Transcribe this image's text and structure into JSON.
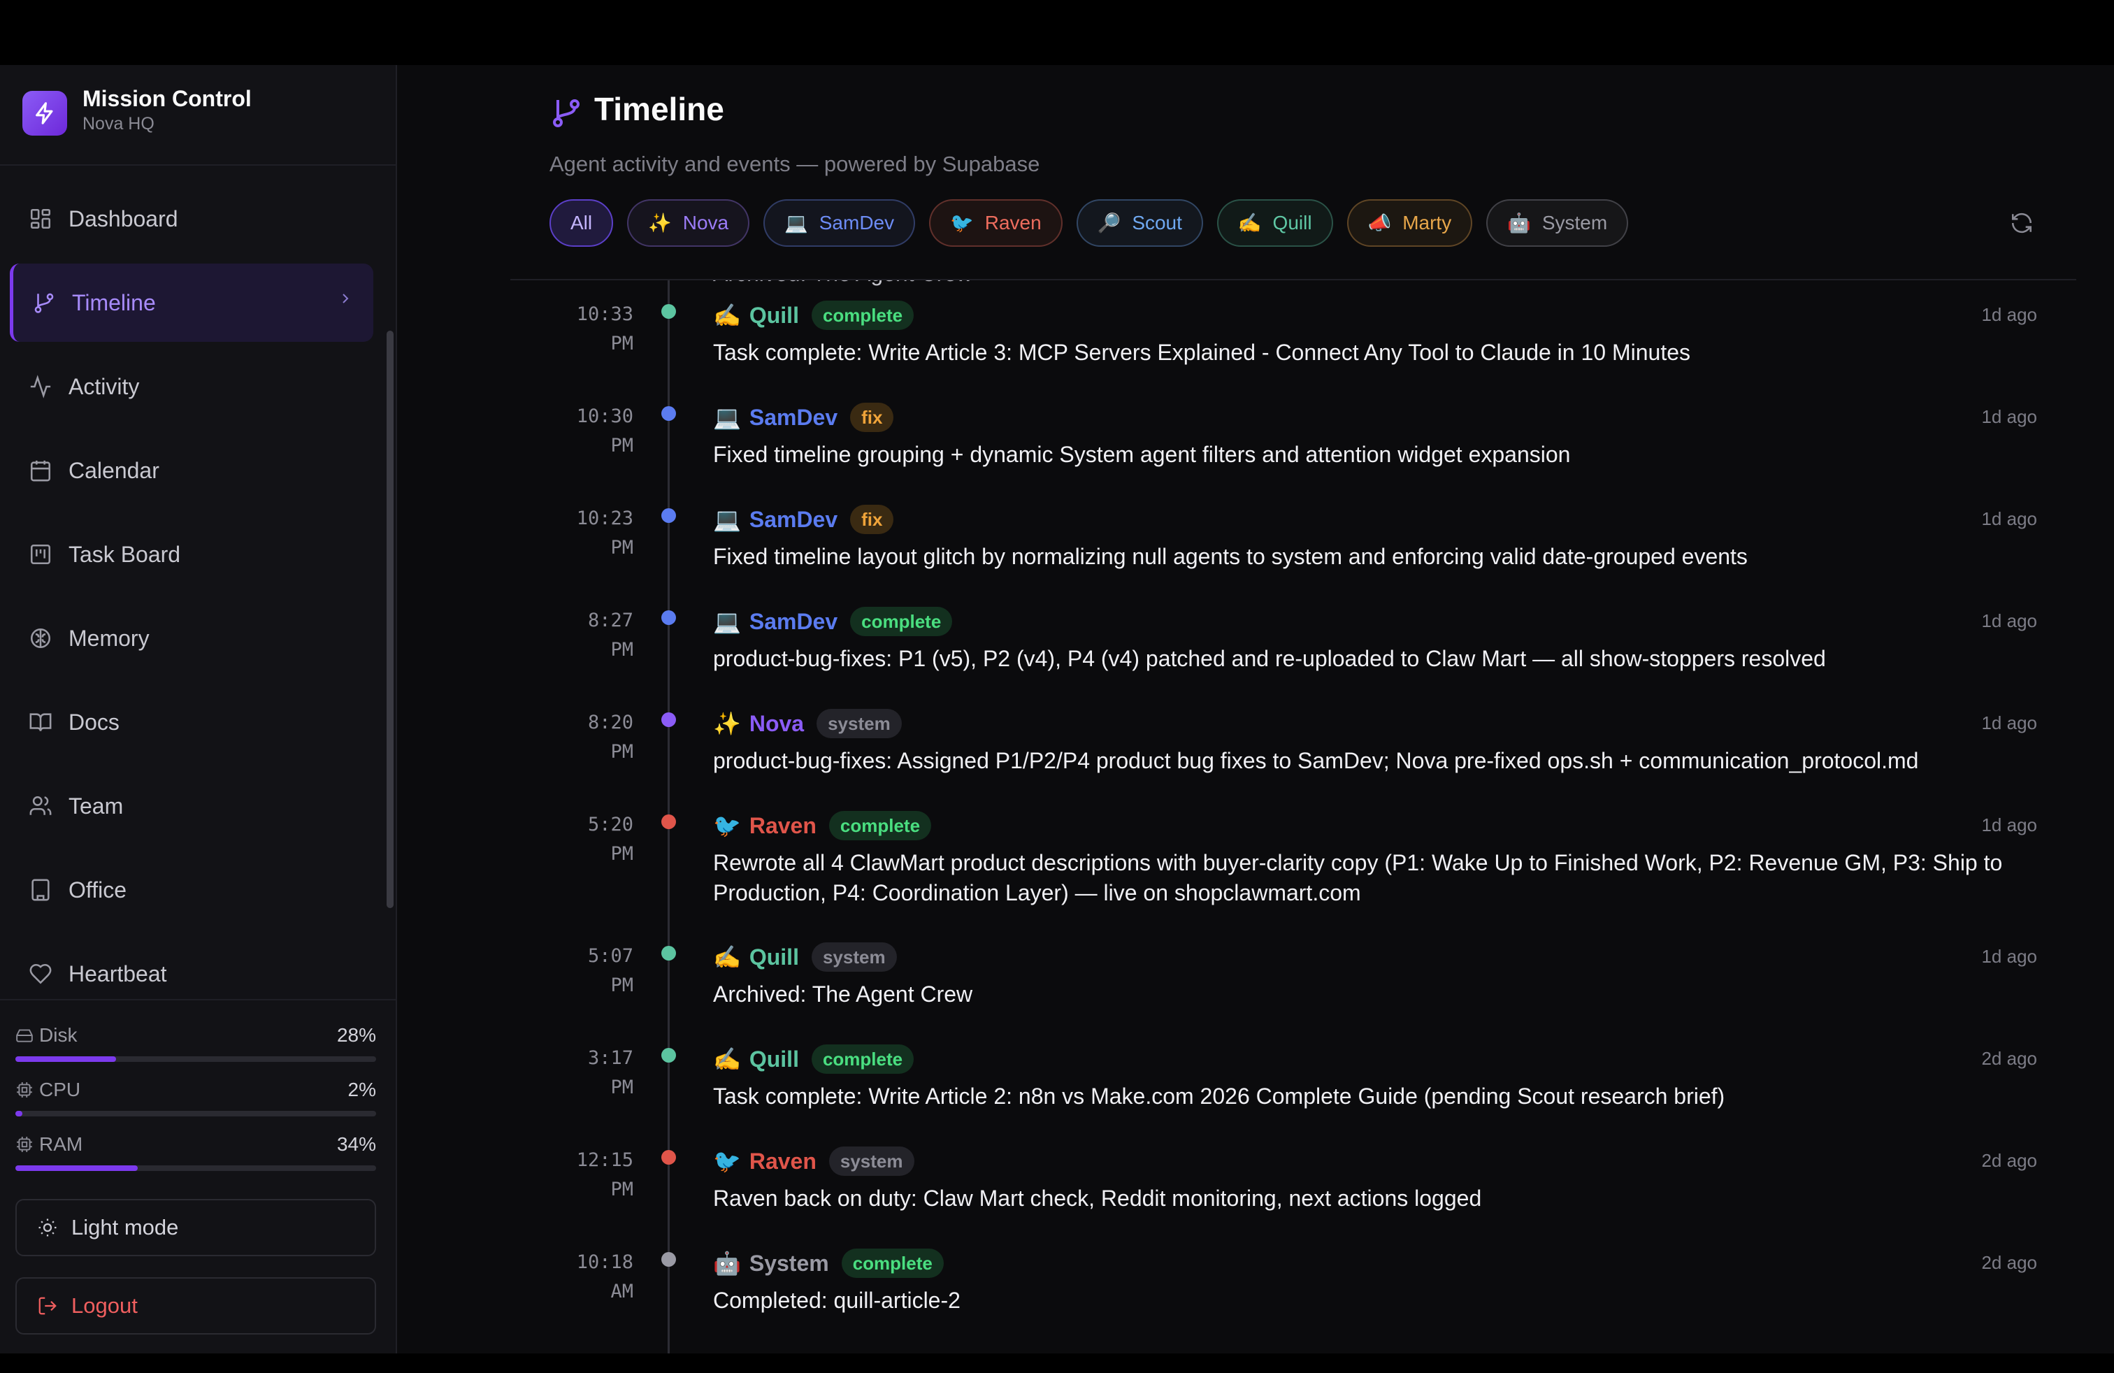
{
  "app": {
    "title": "Mission Control",
    "subtitle": "Nova HQ"
  },
  "sidebar": {
    "items": [
      {
        "label": "Dashboard",
        "icon": "dashboard-icon"
      },
      {
        "label": "Timeline",
        "icon": "branch-icon",
        "active": true
      },
      {
        "label": "Activity",
        "icon": "activity-icon"
      },
      {
        "label": "Calendar",
        "icon": "calendar-icon"
      },
      {
        "label": "Task Board",
        "icon": "kanban-icon"
      },
      {
        "label": "Memory",
        "icon": "brain-icon"
      },
      {
        "label": "Docs",
        "icon": "book-icon"
      },
      {
        "label": "Team",
        "icon": "users-icon"
      },
      {
        "label": "Office",
        "icon": "building-icon"
      },
      {
        "label": "Heartbeat",
        "icon": "heart-icon"
      }
    ],
    "stats": [
      {
        "label": "Disk",
        "value": "28%",
        "level": 0.28
      },
      {
        "label": "CPU",
        "value": "2%",
        "level": 0.02
      },
      {
        "label": "RAM",
        "value": "34%",
        "level": 0.34
      }
    ],
    "light_mode": "Light mode",
    "logout": "Logout"
  },
  "header": {
    "title": "Timeline",
    "subtitle": "Agent activity and events — powered by Supabase"
  },
  "filters": [
    {
      "label": "All",
      "emoji": "",
      "color": "#a78bfa",
      "active": true
    },
    {
      "label": "Nova",
      "emoji": "✨",
      "color": "#9b7cf6"
    },
    {
      "label": "SamDev",
      "emoji": "💻",
      "color": "#6d8cf5"
    },
    {
      "label": "Raven",
      "emoji": "🐦",
      "color": "#ee6d5e"
    },
    {
      "label": "Scout",
      "emoji": "🔎",
      "color": "#6fa8f0"
    },
    {
      "label": "Quill",
      "emoji": "✍️",
      "color": "#5fc7a4"
    },
    {
      "label": "Marty",
      "emoji": "📣",
      "color": "#e7a64a"
    },
    {
      "label": "System",
      "emoji": "🤖",
      "color": "#9a9aa4"
    }
  ],
  "colors": {
    "Quill": "#5cc4a0",
    "SamDev": "#5b7cf0",
    "Nova": "#8b5cf6",
    "Raven": "#e0554a",
    "System": "#9a9aa4"
  },
  "feed": {
    "clipped_text": "Archived: The Agent Crew",
    "events": [
      {
        "time1": "10:33",
        "time2": "PM",
        "agent": "Quill",
        "emoji": "✍️",
        "tag": "complete",
        "ago": "1d ago",
        "text": "Task complete: Write Article 3: MCP Servers Explained - Connect Any Tool to Claude in 10 Minutes"
      },
      {
        "time1": "10:30",
        "time2": "PM",
        "agent": "SamDev",
        "emoji": "💻",
        "tag": "fix",
        "ago": "1d ago",
        "text": "Fixed timeline grouping + dynamic System agent filters and attention widget expansion"
      },
      {
        "time1": "10:23",
        "time2": "PM",
        "agent": "SamDev",
        "emoji": "💻",
        "tag": "fix",
        "ago": "1d ago",
        "text": "Fixed timeline layout glitch by normalizing null agents to system and enforcing valid date-grouped events"
      },
      {
        "time1": "8:27",
        "time2": "PM",
        "agent": "SamDev",
        "emoji": "💻",
        "tag": "complete",
        "ago": "1d ago",
        "text": "product-bug-fixes: P1 (v5), P2 (v4), P4 (v4) patched and re-uploaded to Claw Mart — all show-stoppers resolved"
      },
      {
        "time1": "8:20",
        "time2": "PM",
        "agent": "Nova",
        "emoji": "✨",
        "tag": "system",
        "ago": "1d ago",
        "text": "product-bug-fixes: Assigned P1/P2/P4 product bug fixes to SamDev; Nova pre-fixed ops.sh + communication_protocol.md"
      },
      {
        "time1": "5:20",
        "time2": "PM",
        "agent": "Raven",
        "emoji": "🐦",
        "tag": "complete",
        "ago": "1d ago",
        "text": "Rewrote all 4 ClawMart product descriptions with buyer-clarity copy (P1: Wake Up to Finished Work, P2: Revenue GM, P3: Ship to Production, P4: Coordination Layer) — live on shopclawmart.com"
      },
      {
        "time1": "5:07",
        "time2": "PM",
        "agent": "Quill",
        "emoji": "✍️",
        "tag": "system",
        "ago": "1d ago",
        "text": "Archived: The Agent Crew"
      },
      {
        "time1": "3:17",
        "time2": "PM",
        "agent": "Quill",
        "emoji": "✍️",
        "tag": "complete",
        "ago": "2d ago",
        "text": "Task complete: Write Article 2: n8n vs Make.com 2026 Complete Guide (pending Scout research brief)"
      },
      {
        "time1": "12:15",
        "time2": "PM",
        "agent": "Raven",
        "emoji": "🐦",
        "tag": "system",
        "ago": "2d ago",
        "text": "Raven back on duty: Claw Mart check, Reddit monitoring, next actions logged"
      },
      {
        "time1": "10:18",
        "time2": "AM",
        "agent": "System",
        "emoji": "🤖",
        "tag": "complete",
        "ago": "2d ago",
        "text": "Completed: quill-article-2"
      }
    ]
  }
}
